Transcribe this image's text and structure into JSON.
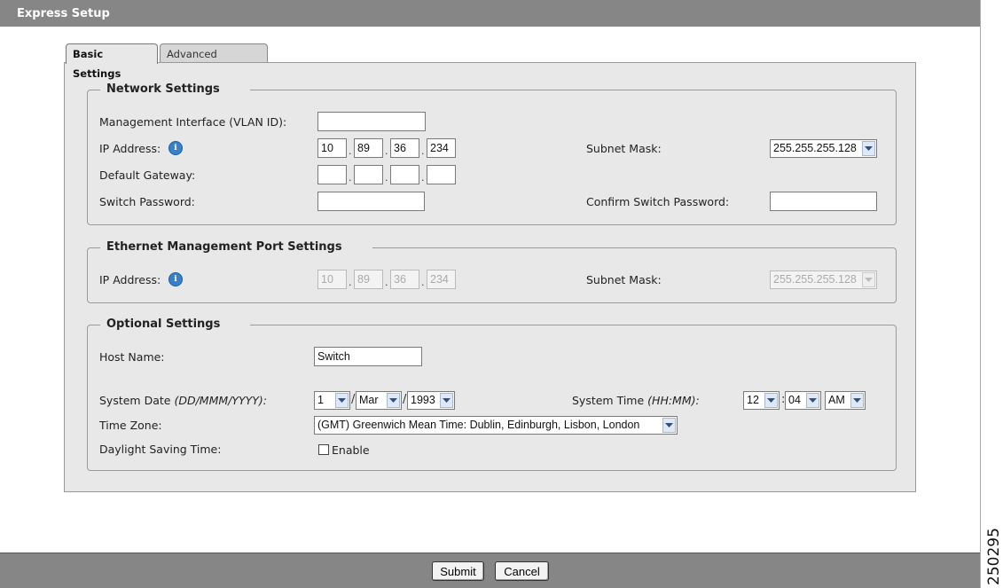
{
  "window": {
    "title": "Express Setup"
  },
  "tabs": [
    {
      "label": "Basic Settings",
      "active": true
    },
    {
      "label": "Advanced Settings",
      "active": false
    }
  ],
  "network": {
    "legend": "Network Settings",
    "mgmt_label": "Management Interface (VLAN ID):",
    "mgmt_value": "",
    "ip_label": "IP Address:",
    "ip": [
      "10",
      "89",
      "36",
      "234"
    ],
    "subnet_label": "Subnet Mask:",
    "subnet_value": "255.255.255.128",
    "gateway_label": "Default Gateway:",
    "gateway": [
      "",
      "",
      "",
      ""
    ],
    "pwd_label": "Switch Password:",
    "confirm_label": "Confirm Switch Password:"
  },
  "ethernet": {
    "legend": "Ethernet Management Port Settings",
    "ip_label": "IP Address:",
    "ip": [
      "10",
      "89",
      "36",
      "234"
    ],
    "subnet_label": "Subnet Mask:",
    "subnet_value": "255.255.255.128"
  },
  "optional": {
    "legend": "Optional Settings",
    "host_label": "Host Name:",
    "host_value": "Switch",
    "date_label": "System Date",
    "date_format": "(DD/MMM/YYYY):",
    "date_day": "1",
    "date_month": "Mar",
    "date_year": "1993",
    "time_label": "System Time",
    "time_format": "(HH:MM):",
    "time_hour": "12",
    "time_minute": "04",
    "time_ampm": "AM",
    "tz_label": "Time Zone:",
    "tz_value": "(GMT) Greenwich Mean Time: Dublin, Edinburgh, Lisbon, London",
    "dst_label": "Daylight Saving Time:",
    "dst_checkbox_label": "Enable",
    "dst_checked": false
  },
  "footer": {
    "submit_label": "Submit",
    "cancel_label": "Cancel"
  },
  "figure_id": "250295",
  "colors": {
    "bar": "#868686",
    "panel": "#e8e8e8",
    "info": "#3a7fc9"
  },
  "icons": {
    "info": "info-icon",
    "dropdown": "chevron-down-icon"
  }
}
